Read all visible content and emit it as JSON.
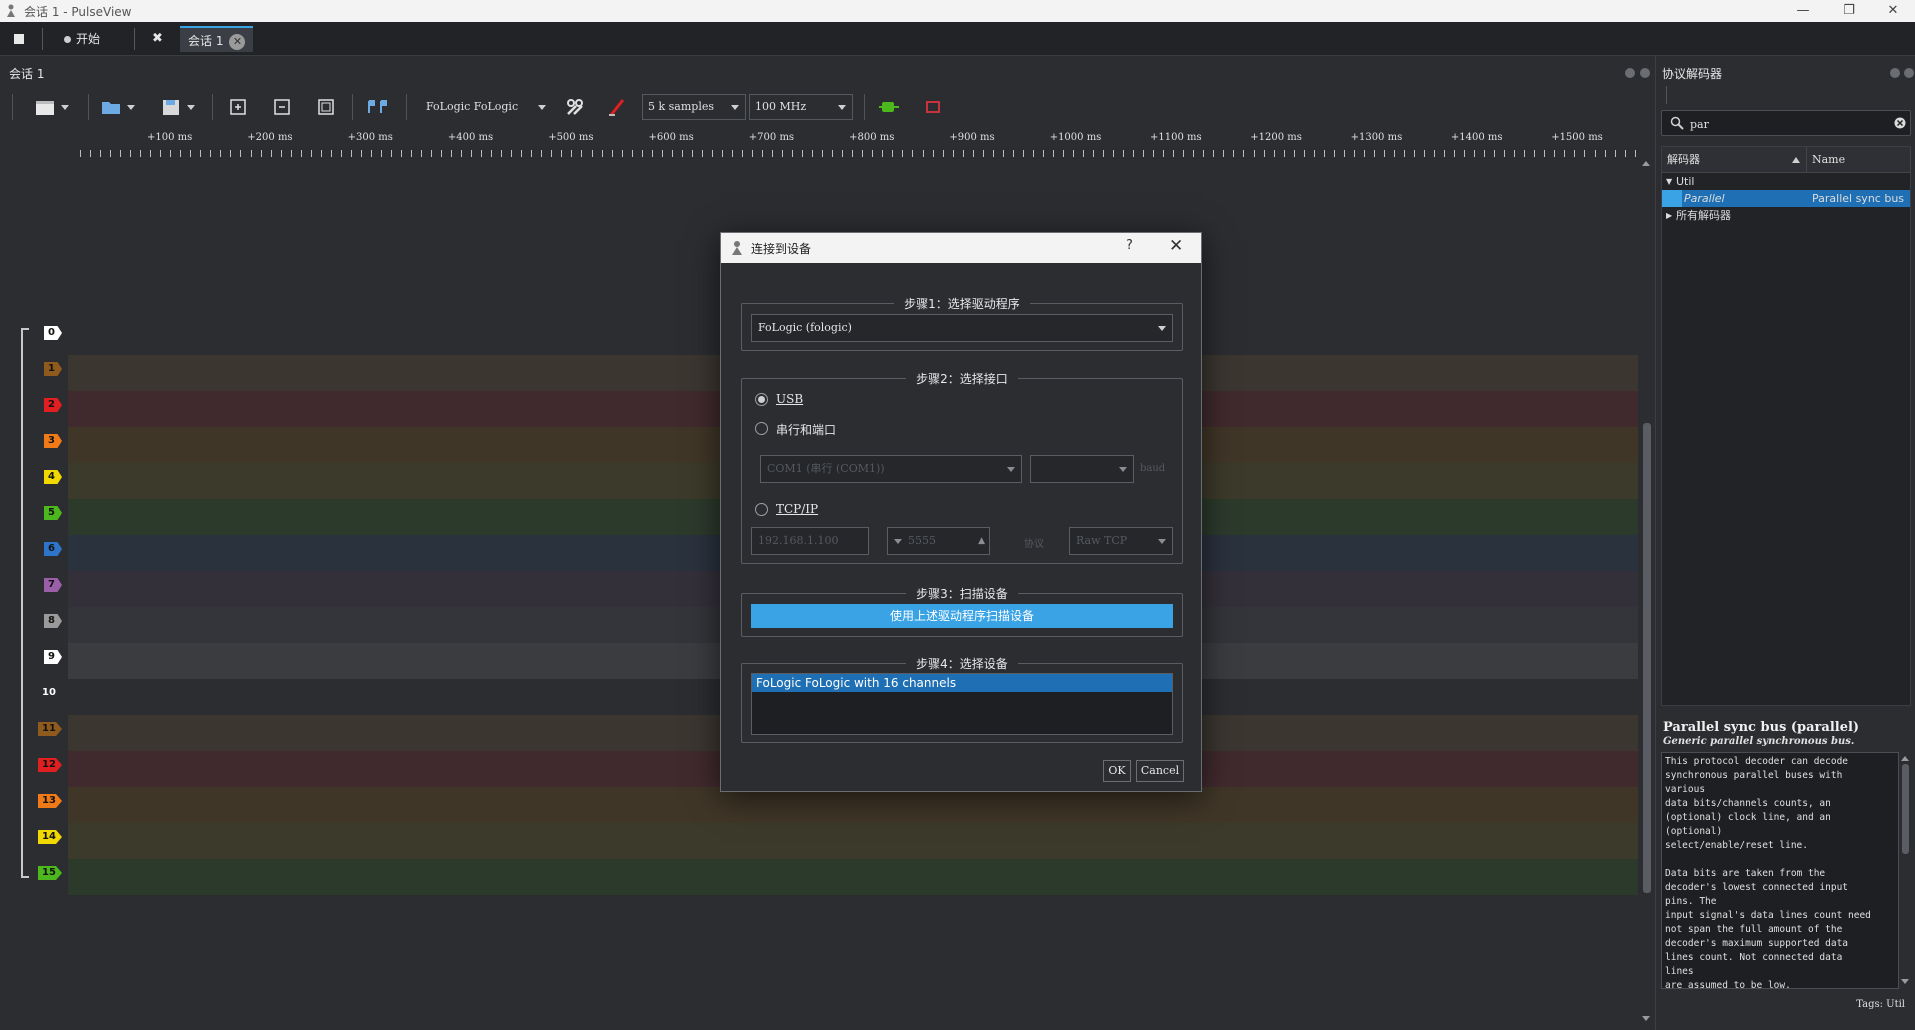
{
  "window": {
    "title": "会话 1 - PulseView",
    "controls": [
      "—",
      "❐",
      "✕"
    ]
  },
  "tabs": {
    "start_label": "开始",
    "session_label": "会话 1",
    "close_glyph": "✕",
    "tools_glyph": "✖"
  },
  "session": {
    "title": "会话 1"
  },
  "toolbar": {
    "device_label": "FoLogic FoLogic",
    "samples_value": "5 k samples",
    "rate_value": "100 MHz"
  },
  "ruler": {
    "labels": [
      "+100 ms",
      "+200 ms",
      "+300 ms",
      "+400 ms",
      "+500 ms",
      "+600 ms",
      "+700 ms",
      "+800 ms",
      "+900 ms",
      "+1000 ms",
      "+1100 ms",
      "+1200 ms",
      "+1300 ms",
      "+1400 ms",
      "+1500 ms"
    ]
  },
  "channels": [
    {
      "name": "0",
      "color": "#ffffff",
      "band": "#2b2d31"
    },
    {
      "name": "1",
      "color": "#8f5a1e",
      "band": "#3b3630"
    },
    {
      "name": "2",
      "color": "#e02020",
      "band": "#402a2e"
    },
    {
      "name": "3",
      "color": "#f07a18",
      "band": "#403628"
    },
    {
      "name": "4",
      "color": "#f0d800",
      "band": "#3c3a2a"
    },
    {
      "name": "5",
      "color": "#4cb81e",
      "band": "#2c3a2c"
    },
    {
      "name": "6",
      "color": "#2e74c8",
      "band": "#2a323e"
    },
    {
      "name": "7",
      "color": "#9b5ea8",
      "band": "#34303a"
    },
    {
      "name": "8",
      "color": "#9a9a9a",
      "band": "#33353a"
    },
    {
      "name": "9",
      "color": "#ffffff",
      "band": "#3a3c40"
    },
    {
      "name": "10",
      "color": "#000000",
      "band": "#2b2d31"
    },
    {
      "name": "11",
      "color": "#8f5a1e",
      "band": "#3b3630"
    },
    {
      "name": "12",
      "color": "#e02020",
      "band": "#402a2e"
    },
    {
      "name": "13",
      "color": "#f07a18",
      "band": "#403628"
    },
    {
      "name": "14",
      "color": "#f0d800",
      "band": "#3c3a2a"
    },
    {
      "name": "15",
      "color": "#4cb81e",
      "band": "#2c3a2c"
    }
  ],
  "right_panel": {
    "title": "协议解码器",
    "search_value": "par",
    "col_decoder": "解码器",
    "col_name": "Name",
    "tree_util": "Util",
    "tree_parallel": "Parallel",
    "tree_parallel_name": "Parallel sync bus",
    "tree_all": "所有解码器",
    "desc_title": "Parallel sync bus (parallel)",
    "desc_subtitle": "Generic parallel synchronous bus.",
    "desc_body": "This protocol decoder can decode\nsynchronous parallel buses with\nvarious\ndata bits/channels counts, an\n(optional) clock line, and an\n(optional)\nselect/enable/reset line.\n\nData bits are taken from the\ndecoder's lowest connected input\npins. The\ninput signal's data lines count need\nnot span the full amount of the\ndecoder's maximum supported data\nlines count. Not connected data\nlines\nare assumed to be low.",
    "tags": "Tags: Util"
  },
  "dialog": {
    "title": "连接到设备",
    "help_glyph": "?",
    "close_glyph": "✕",
    "step1": "步骤1：选择驱动程序",
    "driver_value": "FoLogic (fologic)",
    "step2": "步骤2：选择接口",
    "usb_label": "USB",
    "serial_label": "串行和端口",
    "serial_port_value": "COM1 (串行 (COM1))",
    "baud_label": "baud",
    "tcpip_label": "TCP/IP",
    "host_placeholder": "192.168.1.100",
    "port_value": "5555",
    "protocol_label": "协议",
    "raw_tcp_value": "Raw TCP",
    "step3": "步骤3：扫描设备",
    "scan_button": "使用上述驱动程序扫描设备",
    "step4": "步骤4：选择设备",
    "device_item": "FoLogic FoLogic with 16 channels",
    "ok_label": "OK",
    "cancel_label": "Cancel"
  }
}
